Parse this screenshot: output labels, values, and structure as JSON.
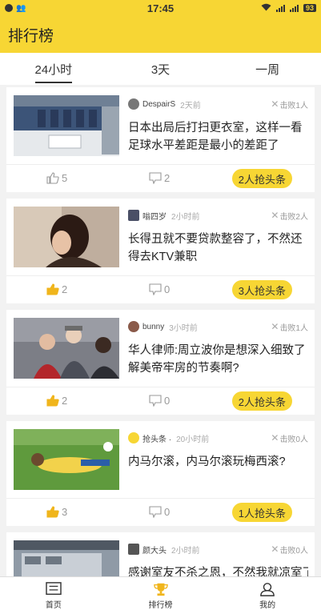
{
  "status_bar": {
    "time": "17:45",
    "battery": "93"
  },
  "header": {
    "title": "排行榜"
  },
  "tabs": [
    {
      "label": "24小时",
      "active": true
    },
    {
      "label": "3天",
      "active": false
    },
    {
      "label": "一周",
      "active": false
    }
  ],
  "posts": [
    {
      "author": "DespairS",
      "time": "2天前",
      "beat": "击败1人",
      "title": "日本出局后打扫更衣室，这样一看足球水平差距是最小的差距了",
      "likes": "5",
      "liked": false,
      "comments": "2",
      "grab": "2人抢头条"
    },
    {
      "author": "嗡四岁",
      "time": "2小时前",
      "beat": "击败2人",
      "title": "长得丑就不要贷款整容了，不然还得去KTV兼职",
      "likes": "2",
      "liked": true,
      "comments": "0",
      "grab": "3人抢头条"
    },
    {
      "author": "bunny",
      "time": "3小时前",
      "beat": "击败1人",
      "title": "华人律师:周立波你是想深入细致了解美帝牢房的节奏啊?",
      "likes": "2",
      "liked": true,
      "comments": "0",
      "grab": "2人抢头条"
    },
    {
      "author": "抢头条 · ",
      "time": "20小时前",
      "beat": "击败0人",
      "title": "内马尔滚，内马尔滚玩梅西滚?",
      "likes": "3",
      "liked": true,
      "comments": "0",
      "grab": "1人抢头条"
    },
    {
      "author": "颜大头",
      "time": "2小时前",
      "beat": "击败0人",
      "title": "感谢室友不杀之恩，不然我就凉室了",
      "likes": "",
      "liked": false,
      "comments": "",
      "grab": ""
    }
  ],
  "bottom_nav": [
    {
      "label": "首页",
      "icon": "home-icon",
      "active": false
    },
    {
      "label": "排行榜",
      "icon": "trophy-icon",
      "active": true
    },
    {
      "label": "我的",
      "icon": "user-icon",
      "active": false
    }
  ],
  "colors": {
    "accent": "#f7d634",
    "liked": "#f0b51c"
  }
}
